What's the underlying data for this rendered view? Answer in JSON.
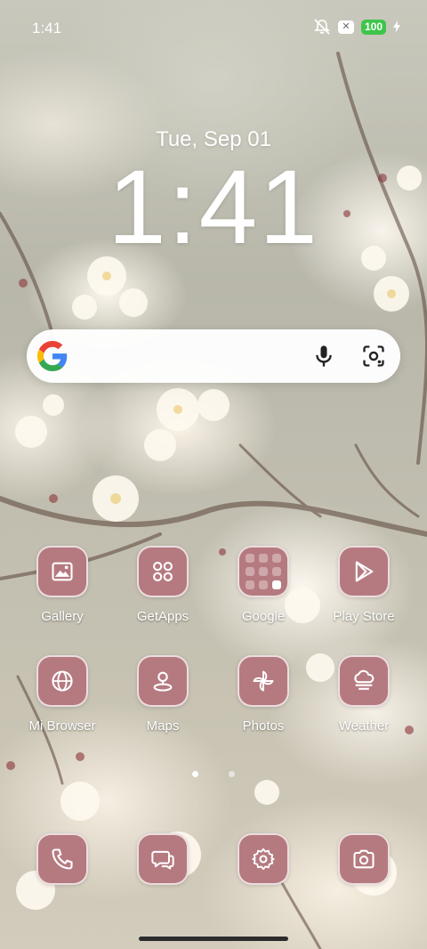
{
  "status_bar": {
    "time": "1:41",
    "battery": "100",
    "icons": [
      "mute-icon",
      "close-badge-icon",
      "battery-icon",
      "charging-icon"
    ]
  },
  "clock": {
    "date": "Tue, Sep 01",
    "time": "1:41"
  },
  "search": {
    "icons": [
      "google-logo-icon",
      "microphone-icon",
      "lens-camera-icon"
    ]
  },
  "apps_row1": [
    {
      "label": "Gallery",
      "icon": "gallery-icon"
    },
    {
      "label": "GetApps",
      "icon": "getapps-icon"
    },
    {
      "label": "Google",
      "icon": "folder-icon"
    },
    {
      "label": "Play Store",
      "icon": "play-store-icon"
    }
  ],
  "apps_row2": [
    {
      "label": "Mi Browser",
      "icon": "globe-icon"
    },
    {
      "label": "Maps",
      "icon": "map-pin-icon"
    },
    {
      "label": "Photos",
      "icon": "pinwheel-icon"
    },
    {
      "label": "Weather",
      "icon": "weather-icon"
    }
  ],
  "dock": [
    {
      "icon": "phone-icon"
    },
    {
      "icon": "messages-icon"
    },
    {
      "icon": "settings-icon"
    },
    {
      "icon": "camera-icon"
    }
  ],
  "page_indicator": {
    "pages": 2,
    "active": 1
  },
  "colors": {
    "icon_tile": "#b57a80",
    "battery_green": "#3ec54a"
  }
}
